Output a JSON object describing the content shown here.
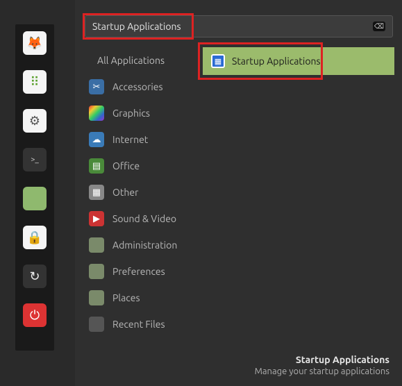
{
  "launcher": {
    "items": [
      {
        "name": "firefox-icon",
        "bg": "li-white",
        "glyph": "🦊"
      },
      {
        "name": "apps-icon",
        "bg": "li-white",
        "glyph": "⠿",
        "glyphColor": "#5aa02c"
      },
      {
        "name": "settings-icon",
        "bg": "li-white",
        "glyph": "⚙",
        "glyphColor": "#555"
      },
      {
        "name": "terminal-icon",
        "bg": "li-dark",
        "glyph": ">_",
        "glyphColor": "#ccc",
        "small": true
      },
      {
        "name": "files-icon",
        "bg": "li-green",
        "glyph": "",
        "glyphColor": "#fff"
      },
      {
        "name": "lock-icon",
        "bg": "li-white",
        "glyph": "🔒",
        "glyphColor": "#222"
      },
      {
        "name": "refresh-icon",
        "bg": "li-dark",
        "glyph": "↻",
        "glyphColor": "#eee"
      },
      {
        "name": "power-icon",
        "bg": "li-red",
        "glyph": "⏻",
        "glyphColor": "#fff"
      }
    ]
  },
  "search": {
    "value": "Startup Applications",
    "clear_glyph": "⌫"
  },
  "categories": [
    {
      "label": "All Applications",
      "icon": "",
      "cls": "",
      "all": true
    },
    {
      "label": "Accessories",
      "icon": "✂",
      "cls": "ci-blue"
    },
    {
      "label": "Graphics",
      "icon": "",
      "cls": "ci-rainbow"
    },
    {
      "label": "Internet",
      "icon": "☁",
      "cls": "ci-cloud"
    },
    {
      "label": "Office",
      "icon": "▤",
      "cls": "ci-green"
    },
    {
      "label": "Other",
      "icon": "▦",
      "cls": "ci-grey"
    },
    {
      "label": "Sound & Video",
      "icon": "▶",
      "cls": "ci-red"
    },
    {
      "label": "Administration",
      "icon": "",
      "cls": "ci-folder"
    },
    {
      "label": "Preferences",
      "icon": "",
      "cls": "ci-folder"
    },
    {
      "label": "Places",
      "icon": "",
      "cls": "ci-folder"
    },
    {
      "label": "Recent Files",
      "icon": "",
      "cls": "ci-dark"
    }
  ],
  "result": {
    "label": "Startup Applications",
    "icon_glyph": "▦"
  },
  "description": {
    "title": "Startup Applications",
    "subtitle": "Manage your startup applications"
  },
  "highlights": {
    "search_box": "#d22",
    "result_box": "#d22"
  }
}
